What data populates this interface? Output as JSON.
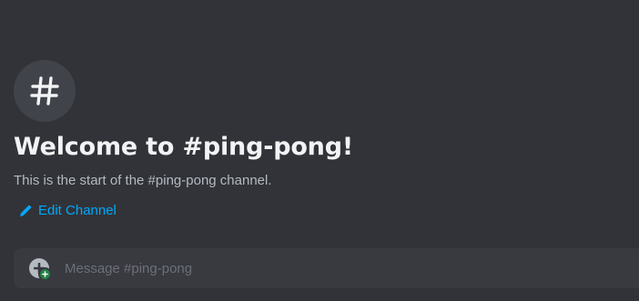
{
  "channel": {
    "icon": "hashtag-icon",
    "welcome_title": "Welcome to #ping-pong!",
    "welcome_description": "This is the start of the #ping-pong channel.",
    "edit_label": "Edit Channel"
  },
  "composer": {
    "placeholder": "Message #ping-pong",
    "value": ""
  },
  "colors": {
    "background": "#313338",
    "icon_circle": "#41434a",
    "title": "#f2f3f5",
    "description": "#b5bac1",
    "link": "#00a8fc",
    "composer_bg": "#383a40"
  }
}
